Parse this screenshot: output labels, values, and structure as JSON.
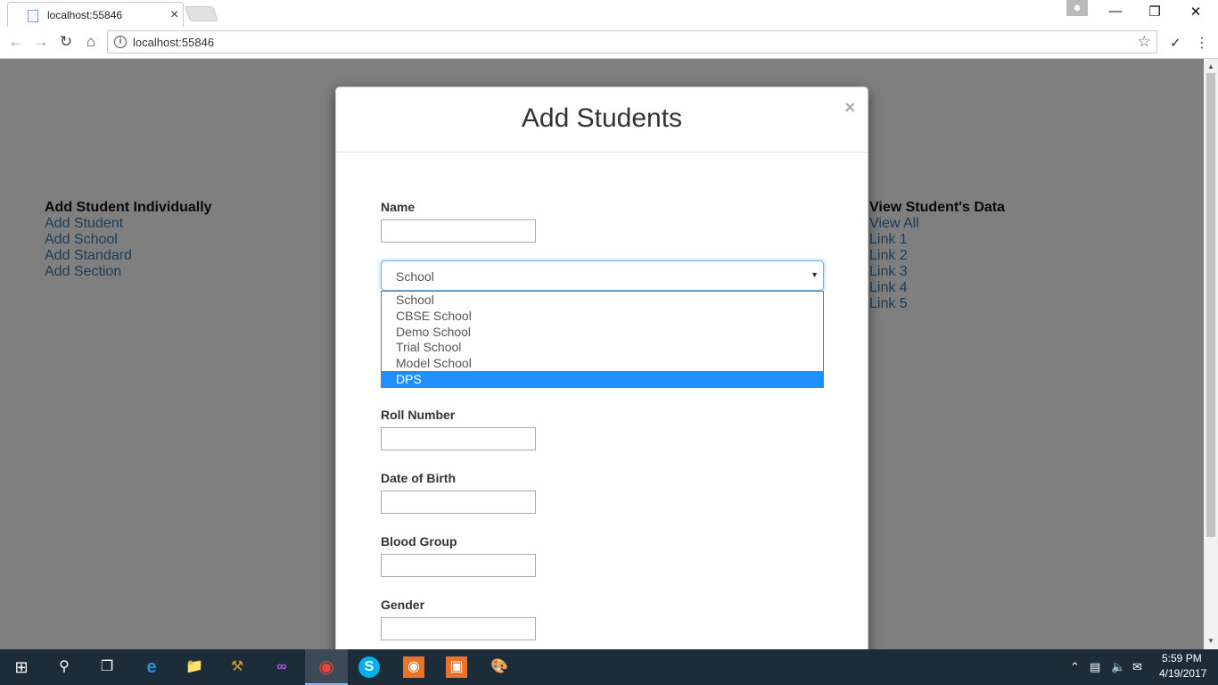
{
  "browser": {
    "tab_title": "localhost:55846",
    "tab_close": "×",
    "url": "localhost:55846",
    "profile_icon": "person-icon",
    "window_minimize": "—",
    "window_restore": "❐",
    "window_close": "✕"
  },
  "page": {
    "left_heading": "Add Student Individually",
    "left_links": [
      "Add Student",
      "Add School",
      "Add Standard",
      "Add Section"
    ],
    "right_heading": "View Student's Data",
    "right_links": [
      "View All",
      "Link 1",
      "Link 2",
      "Link 3",
      "Link 4",
      "Link 5"
    ],
    "link_color": "#337ab7"
  },
  "modal": {
    "title": "Add Students",
    "close": "×",
    "name_label": "Name",
    "school_select": {
      "value": "School",
      "options": [
        "School",
        "CBSE School",
        "Demo School",
        "Trial School",
        "Model School",
        "DPS"
      ],
      "highlighted": "DPS",
      "highlight_color": "#1e90ff"
    },
    "roll_label": "Roll Number",
    "dob_label": "Date of Birth",
    "blood_label": "Blood Group",
    "gender_label": "Gender"
  },
  "taskbar": {
    "time": "5:59 PM",
    "date": "4/19/2017",
    "active_app": "chrome-icon"
  }
}
